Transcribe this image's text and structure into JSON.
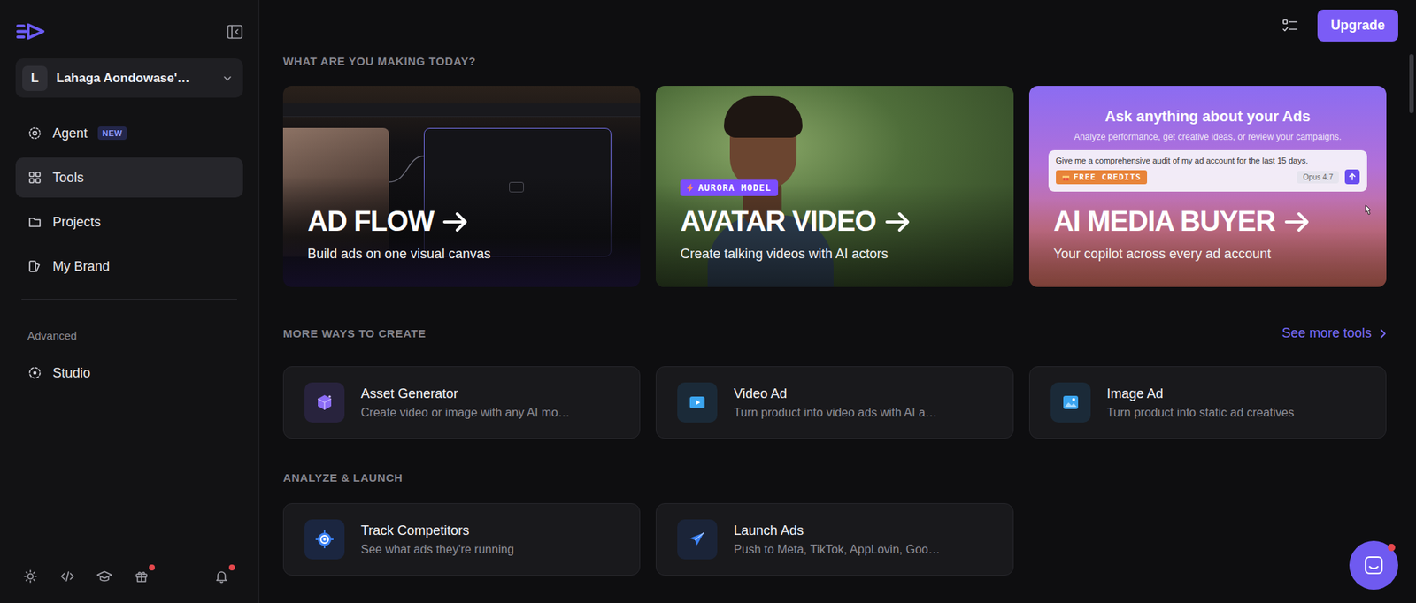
{
  "sidebar": {
    "workspace": {
      "initial": "L",
      "name": "Lahaga Aondowase'…"
    },
    "nav": [
      {
        "label": "Agent",
        "badge": "NEW",
        "kind": "agent",
        "selected": false
      },
      {
        "label": "Tools",
        "kind": "tools",
        "selected": true
      },
      {
        "label": "Projects",
        "kind": "projects",
        "selected": false
      },
      {
        "label": "My Brand",
        "kind": "brand",
        "selected": false
      }
    ],
    "advanced": {
      "label": "Advanced",
      "items": [
        {
          "label": "Studio",
          "kind": "studio",
          "selected": false
        }
      ]
    },
    "footer_icons": [
      {
        "kind": "sun",
        "has_dot": false
      },
      {
        "kind": "code",
        "has_dot": false
      },
      {
        "kind": "learn",
        "has_dot": false
      },
      {
        "kind": "gift",
        "has_dot": true
      },
      {
        "kind": "bell",
        "has_dot": true
      }
    ]
  },
  "header": {
    "upgrade": "Upgrade"
  },
  "hero": {
    "title": "WHAT ARE YOU MAKING TODAY?",
    "cards": [
      {
        "kind": "ad-flow",
        "title": "AD FLOW",
        "subtitle": "Build ads on one visual canvas"
      },
      {
        "kind": "avatar",
        "badge": "AURORA MODEL",
        "title": "AVATAR VIDEO",
        "subtitle": "Create talking videos with AI actors"
      },
      {
        "kind": "media-buyer",
        "title": "AI MEDIA BUYER",
        "subtitle": "Your copilot across every ad account",
        "mock": {
          "heading": "Ask anything about your Ads",
          "subheading": "Analyze performance, get creative ideas, or review your campaigns.",
          "prompt": "Give me a comprehensive audit of my ad account for the last 15 days.",
          "badge": "FREE CREDITS",
          "model": "Opus 4.7"
        }
      }
    ]
  },
  "create": {
    "title": "MORE WAYS TO CREATE",
    "link": "See more tools",
    "tools": [
      {
        "kind": "asset",
        "name": "Asset Generator",
        "description": "Create video or image with any AI mo…"
      },
      {
        "kind": "video",
        "name": "Video Ad",
        "description": "Turn product into video ads with AI a…"
      },
      {
        "kind": "image",
        "name": "Image Ad",
        "description": "Turn product into static ad creatives"
      }
    ]
  },
  "analyze": {
    "title": "ANALYZE & LAUNCH",
    "tools": [
      {
        "kind": "competitors",
        "name": "Track Competitors",
        "description": "See what ads they're running"
      },
      {
        "kind": "launch",
        "name": "Launch Ads",
        "description": "Push to Meta, TikTok, AppLovin, Goo…"
      }
    ]
  },
  "chat": {
    "has_dot": true
  }
}
